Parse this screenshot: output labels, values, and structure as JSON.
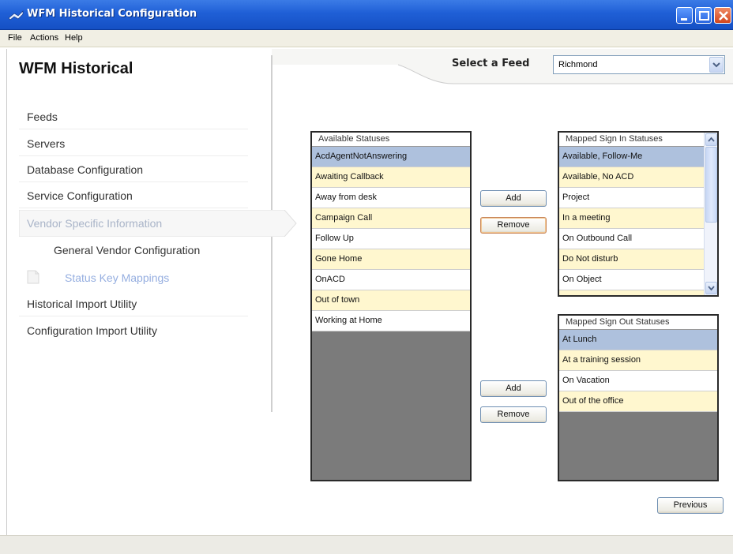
{
  "window": {
    "title": "WFM Historical Configuration"
  },
  "menu": {
    "items": [
      "File",
      "Actions",
      "Help"
    ]
  },
  "sidebar": {
    "title": "WFM Historical",
    "items": [
      {
        "label": "Feeds"
      },
      {
        "label": "Servers"
      },
      {
        "label": "Database Configuration"
      },
      {
        "label": "Service Configuration"
      },
      {
        "label": "Vendor Specific Information"
      },
      {
        "label": "General Vendor Configuration"
      },
      {
        "label": "Status Key Mappings"
      },
      {
        "label": "Historical Import Utility"
      },
      {
        "label": "Configuration Import Utility"
      }
    ]
  },
  "feed": {
    "label": "Select a Feed",
    "value": "Richmond"
  },
  "available": {
    "header": "Available Statuses",
    "rows": [
      "AcdAgentNotAnswering",
      "Awaiting Callback",
      "Away from desk",
      "Campaign Call",
      "Follow Up",
      "Gone Home",
      "OnACD",
      "Out of town",
      "Working at Home"
    ]
  },
  "sign_in": {
    "header": "Mapped Sign In Statuses",
    "rows": [
      "Available, Follow-Me",
      "Available, No ACD",
      "Project",
      "In a meeting",
      "On Outbound Call",
      "Do Not disturb",
      "On Object"
    ]
  },
  "sign_out": {
    "header": "Mapped Sign Out Statuses",
    "rows": [
      "At Lunch",
      "At a training session",
      "On Vacation",
      "Out of the office"
    ]
  },
  "buttons": {
    "add": "Add",
    "remove": "Remove",
    "previous": "Previous"
  },
  "colors": {
    "titlebar": "#1f5fd6",
    "row_selected": "#aec1dd",
    "row_alt": "#fff7cf",
    "list_empty": "#7b7b7b"
  }
}
